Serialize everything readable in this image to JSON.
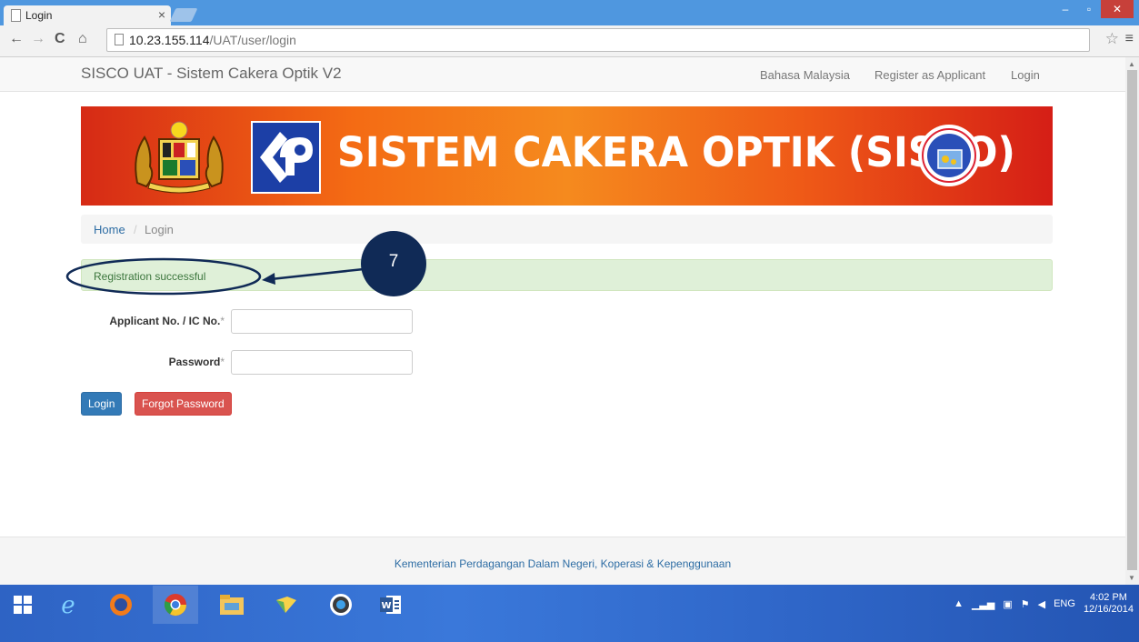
{
  "browser": {
    "tab_title": "Login",
    "tab_close": "×",
    "url_host": "10.23.155.114",
    "url_path": "/UAT/user/login",
    "back": "←",
    "forward": "→",
    "reload": "C",
    "home": "⌂",
    "star": "☆",
    "menu": "≡",
    "win_min": "–",
    "win_max": "▫",
    "win_close": "✕"
  },
  "navbar": {
    "brand": "SISCO UAT - Sistem Cakera Optik V2",
    "links": [
      "Bahasa Malaysia",
      "Register as Applicant",
      "Login"
    ]
  },
  "banner": {
    "title": "SISTEM CAKERA OPTIK (SISCO)"
  },
  "breadcrumb": {
    "home": "Home",
    "separator": "/",
    "current": "Login"
  },
  "alert": {
    "message": "Registration successful"
  },
  "annotation": {
    "number": "7"
  },
  "form": {
    "applicant_label": "Applicant No. / IC No.",
    "password_label": "Password",
    "required_mark": "*",
    "applicant_value": "",
    "password_value": "",
    "login_button": "Login",
    "forgot_button": "Forgot Password"
  },
  "footer": {
    "text": "Kementerian Perdagangan Dalam Negeri, Koperasi & Kepenggunaan"
  },
  "taskbar": {
    "apps": [
      "windows-start",
      "internet-explorer",
      "firefox",
      "chrome",
      "file-explorer",
      "photos",
      "skype",
      "word"
    ],
    "language": "ENG",
    "time": "4:02 PM",
    "date": "12/16/2014"
  },
  "colors": {
    "primary": "#337ab7",
    "danger": "#d9534f",
    "success_bg": "#dff0d8",
    "success_text": "#3c763d",
    "annotation": "#102a56"
  }
}
